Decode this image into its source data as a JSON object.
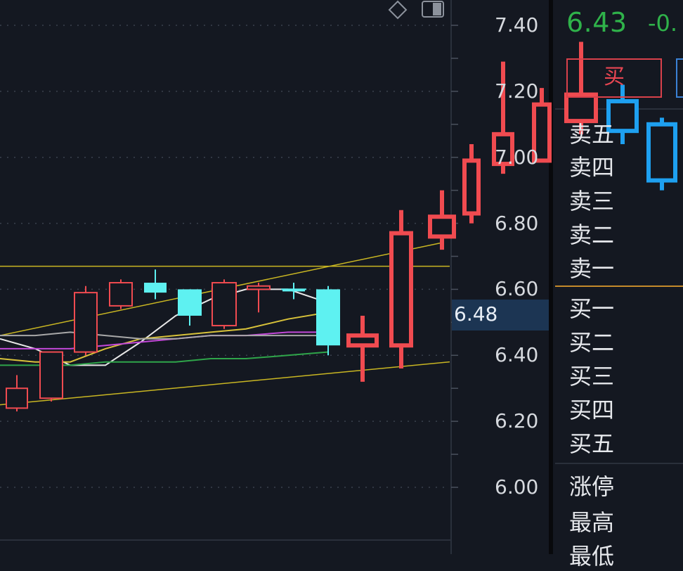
{
  "quote": {
    "last_price": "6.43",
    "change_partial": "-0."
  },
  "trade": {
    "buy_label": "买"
  },
  "order_book": {
    "ask_labels": [
      "卖五",
      "卖四",
      "卖三",
      "卖二",
      "卖一"
    ],
    "bid_labels": [
      "买一",
      "买二",
      "买三",
      "买四",
      "买五"
    ],
    "stat_labels": [
      "涨停",
      "最高",
      "最低"
    ]
  },
  "toolbar_icons": [
    "diamond-icon",
    "panel-toggle-icon"
  ],
  "crosshair_price": "6.48",
  "colors": {
    "background": "#141821",
    "up": "#f04b50",
    "down_main": "#5ef1f1",
    "down_right": "#1ea0f0",
    "quote_green": "#2fb24a",
    "channel_yellow": "#c9b622",
    "separator": "#c48a2a"
  },
  "chart_data": {
    "type": "candlestick",
    "y_axis": {
      "ticks": [
        "7.40",
        "7.20",
        "7.00",
        "6.80",
        "6.60",
        "6.40",
        "6.20",
        "6.00"
      ],
      "ylim": [
        5.95,
        7.48
      ]
    },
    "candles": [
      {
        "o": 6.3,
        "h": 6.34,
        "l": 6.23,
        "c": 6.24,
        "dir": "up"
      },
      {
        "o": 6.27,
        "h": 6.41,
        "l": 6.26,
        "c": 6.41,
        "dir": "up"
      },
      {
        "o": 6.41,
        "h": 6.61,
        "l": 6.4,
        "c": 6.59,
        "dir": "up"
      },
      {
        "o": 6.55,
        "h": 6.63,
        "l": 6.54,
        "c": 6.62,
        "dir": "up"
      },
      {
        "o": 6.62,
        "h": 6.66,
        "l": 6.57,
        "c": 6.59,
        "dir": "down"
      },
      {
        "o": 6.6,
        "h": 6.6,
        "l": 6.49,
        "c": 6.52,
        "dir": "down"
      },
      {
        "o": 6.49,
        "h": 6.63,
        "l": 6.48,
        "c": 6.62,
        "dir": "up"
      },
      {
        "o": 6.6,
        "h": 6.62,
        "l": 6.53,
        "c": 6.61,
        "dir": "up"
      },
      {
        "o": 6.6,
        "h": 6.62,
        "l": 6.57,
        "c": 6.6,
        "dir": "down"
      },
      {
        "o": 6.6,
        "h": 6.61,
        "l": 6.4,
        "c": 6.43,
        "dir": "down"
      },
      {
        "o": 6.43,
        "h": 6.52,
        "l": 6.32,
        "c": 6.46,
        "dir": "up"
      },
      {
        "o": 6.43,
        "h": 6.84,
        "l": 6.36,
        "c": 6.77,
        "dir": "up"
      },
      {
        "o": 6.76,
        "h": 6.9,
        "l": 6.72,
        "c": 6.82,
        "dir": "up"
      },
      {
        "o": 6.83,
        "h": 7.04,
        "l": 6.8,
        "c": 6.99,
        "dir": "up"
      },
      {
        "o": 6.98,
        "h": 7.29,
        "l": 6.95,
        "c": 7.07,
        "dir": "up"
      },
      {
        "o": 6.99,
        "h": 7.21,
        "l": 6.99,
        "c": 7.16,
        "dir": "up"
      },
      {
        "o": 7.11,
        "h": 7.35,
        "l": 7.07,
        "c": 7.19,
        "dir": "up"
      },
      {
        "o": 7.17,
        "h": 7.22,
        "l": 7.04,
        "c": 7.08,
        "dir": "down"
      },
      {
        "o": 7.1,
        "h": 7.12,
        "l": 6.9,
        "c": 6.93,
        "dir": "down"
      }
    ],
    "moving_averages": [
      {
        "color": "#e8e8e8",
        "values": [
          6.45,
          6.42,
          6.37,
          6.37,
          6.44,
          6.52,
          6.57,
          6.6,
          6.6,
          6.56
        ]
      },
      {
        "color": "#d8c23a",
        "values": [
          6.39,
          6.38,
          6.38,
          6.42,
          6.45,
          6.46,
          6.47,
          6.48,
          6.51,
          6.53
        ]
      },
      {
        "color": "#c248d8",
        "values": [
          6.42,
          6.42,
          6.42,
          6.43,
          6.44,
          6.45,
          6.46,
          6.46,
          6.47,
          6.47
        ]
      },
      {
        "color": "#2fa54a",
        "values": [
          6.37,
          6.37,
          6.37,
          6.38,
          6.38,
          6.38,
          6.39,
          6.39,
          6.4,
          6.41
        ]
      },
      {
        "color": "#a8a8a8",
        "values": [
          6.46,
          6.46,
          6.47,
          6.46,
          6.45,
          6.45,
          6.46,
          6.46,
          6.46,
          6.46
        ]
      }
    ],
    "channel_lines": [
      {
        "from": 6.46,
        "to": 6.74
      },
      {
        "from": 6.25,
        "to": 6.38
      }
    ],
    "resistance_level": 6.67
  }
}
